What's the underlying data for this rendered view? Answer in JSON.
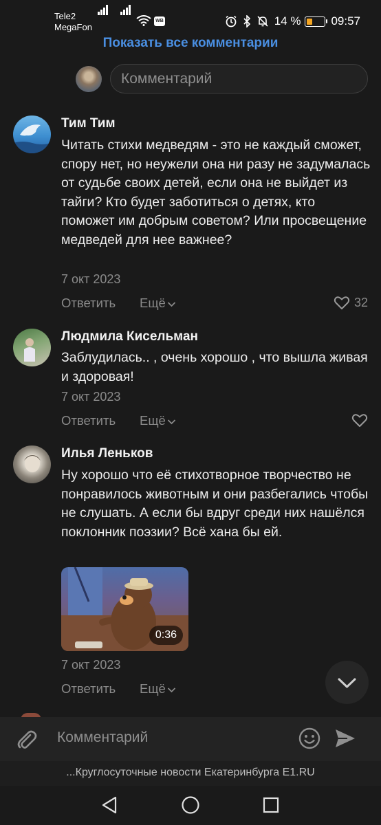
{
  "status_bar": {
    "carrier1": "Tele2",
    "carrier2": "MegaFon",
    "vk_badge": "WB",
    "battery": "14 %",
    "battery_level": 0.14,
    "time": "09:57"
  },
  "show_all": "Показать все комментарии",
  "top_input_placeholder": "Комментарий",
  "comments": [
    {
      "author": "Тим Тим",
      "text": "Читать стихи медведям - это не каждый сможет, спору нет, но неужели она ни разу не задумалась от судьбе своих детей, если она не выйдет из тайги? Кто будет заботиться о детях, кто поможет им добрым советом? Или просвещение медведей для нее важнее?",
      "date": "7 окт 2023",
      "reply": "Ответить",
      "more": "Ещё",
      "likes": "32"
    },
    {
      "author": "Людмила Кисельман",
      "text": "Заблудилась.. , очень хорошо , что вышла живая и здоровая!",
      "date": "7 окт 2023",
      "reply": "Ответить",
      "more": "Ещё"
    },
    {
      "author": "Илья Леньков",
      "text": "Ну хорошо что её стихотворное творчество не понравилось животным и они разбегались чтобы не слушать. А если бы вдруг среди них нашёлся поклонник поэзии? Всё хана бы ей.",
      "video_duration": "0:36",
      "date": "7 окт 2023",
      "reply": "Ответить",
      "more": "Ещё"
    }
  ],
  "bottom_input_placeholder": "Комментарий",
  "source": "...Круглосуточные новости Екатеринбурга E1.RU",
  "icons": {
    "signal": "signal-icon",
    "wifi": "wifi-icon",
    "alarm": "alarm-icon",
    "bluetooth": "bluetooth-icon",
    "mute": "bell-off-icon",
    "heart": "heart-icon",
    "chevron": "chevron-down-icon",
    "attach": "paperclip-icon",
    "emoji": "emoji-icon",
    "send": "send-icon",
    "back": "back-icon",
    "home": "home-icon",
    "recent": "recent-apps-icon"
  },
  "colors": {
    "accent": "#4a8fe2",
    "background": "#1a1a1a",
    "battery_low": "#f5a623"
  }
}
